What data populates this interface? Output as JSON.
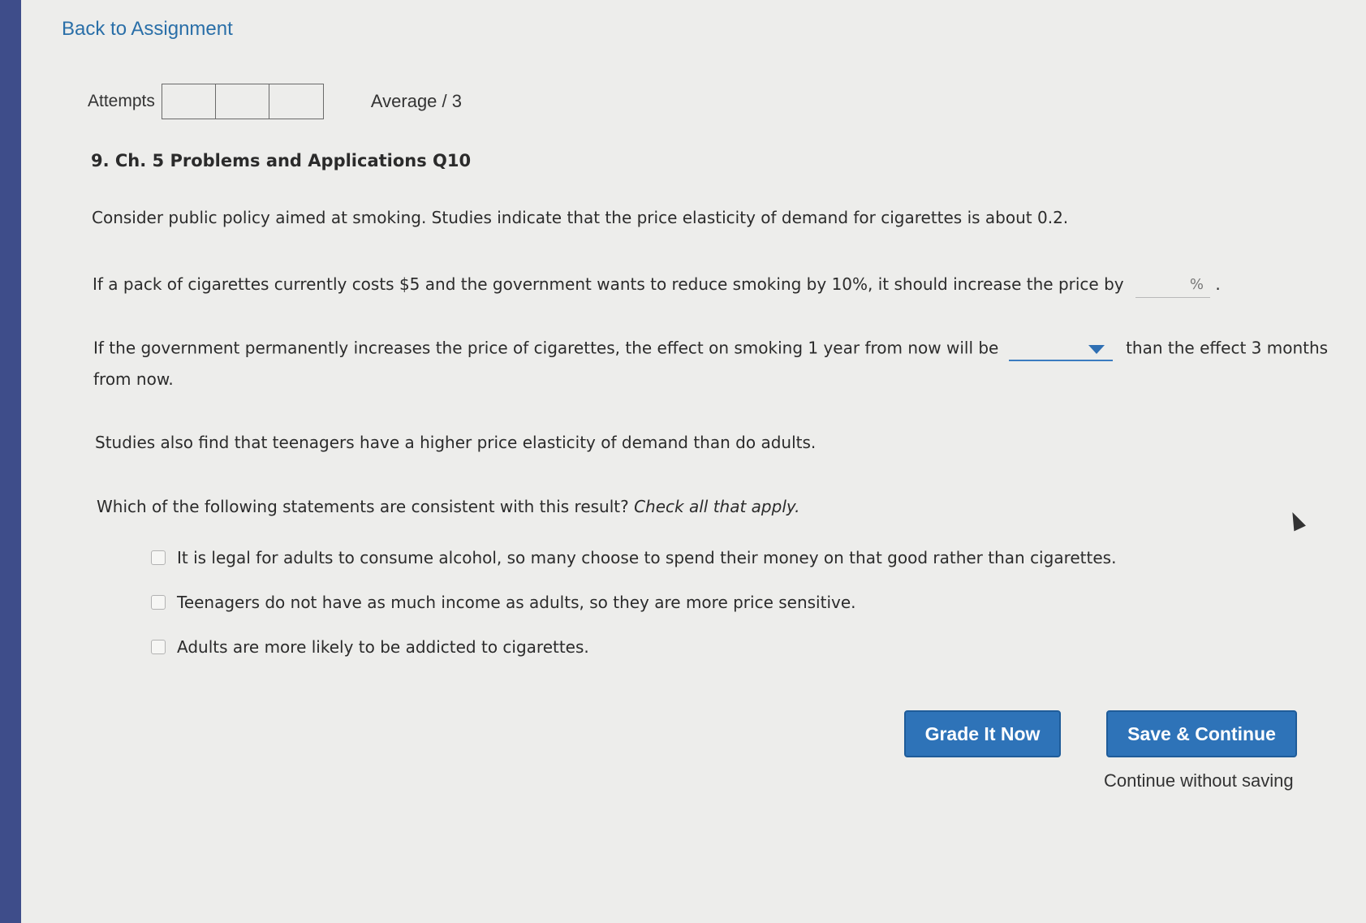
{
  "nav": {
    "back_label": "Back to Assignment"
  },
  "attempts": {
    "label": "Attempts",
    "average_label": "Average / 3"
  },
  "question": {
    "title": "9. Ch. 5 Problems and Applications Q10",
    "p1": "Consider public policy aimed at smoking. Studies indicate that the price elasticity of demand for cigarettes is about 0.2.",
    "p2_before": "If a pack of cigarettes currently costs $5 and the government wants to reduce smoking by 10%, it should increase the price by",
    "p2_unit": "%",
    "p2_after": ".",
    "p3_before": "If the government permanently increases the price of cigarettes, the effect on smoking 1 year from now will be",
    "p3_after": "than the effect 3 months",
    "p3_line2": "from now.",
    "p4": "Studies also find that teenagers have a higher price elasticity of demand than do adults.",
    "p5_main": "Which of the following statements are consistent with this result?",
    "p5_italic": "Check all that apply.",
    "choices": [
      {
        "label": "It is legal for adults to consume alcohol, so many choose to spend their money on that good rather than cigarettes.",
        "checked": false
      },
      {
        "label": "Teenagers do not have as much income as adults, so they are more price sensitive.",
        "checked": false
      },
      {
        "label": "Adults are more likely to be addicted to cigarettes.",
        "checked": false
      }
    ]
  },
  "actions": {
    "grade_label": "Grade It Now",
    "save_label": "Save & Continue",
    "continue_label": "Continue without saving"
  },
  "colors": {
    "accent": "#2e73b8",
    "sidebar": "#3e4d8a",
    "link": "#2a6fa8"
  }
}
